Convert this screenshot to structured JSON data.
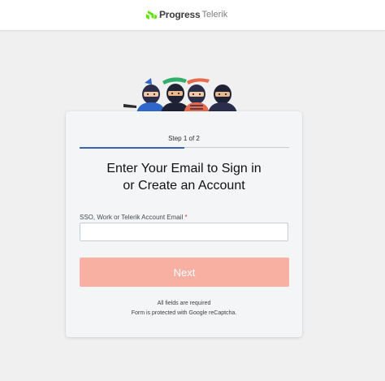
{
  "header": {
    "brand_primary": "Progress",
    "brand_secondary": "Telerik",
    "brand_color": "#5ce500"
  },
  "form": {
    "step_label": "Step 1 of 2",
    "step_progress": 0.5,
    "title_line1": "Enter Your Email to Sign in",
    "title_line2": "or Create an Account",
    "email_label": "SSO, Work or Telerik Account Email",
    "required_mark": "*",
    "email_value": "",
    "email_placeholder": "",
    "next_label": "Next",
    "next_color": "#f8b0a3",
    "required_note": "All fields are required",
    "captcha_note": "Form is protected with Google reCaptcha."
  }
}
